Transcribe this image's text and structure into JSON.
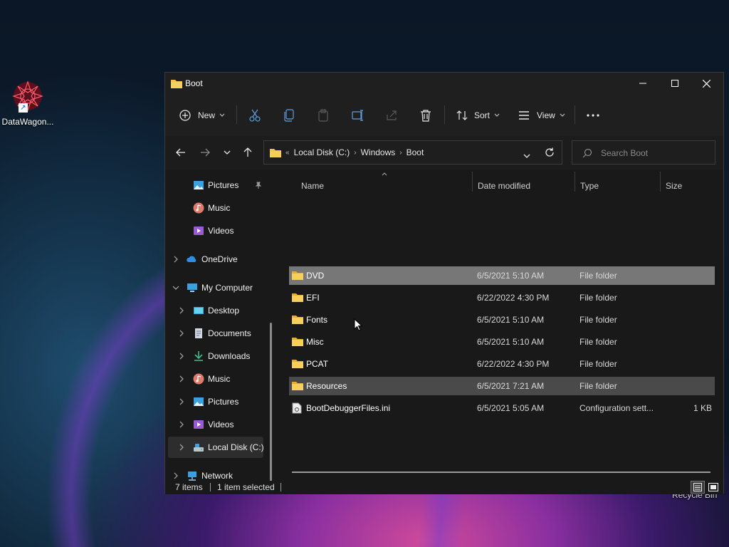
{
  "desktop": {
    "icons": [
      {
        "label": "DataWagon...",
        "icon": "datawagon-logo-icon"
      }
    ],
    "recycle_bin_label": "Recycle Bin"
  },
  "window": {
    "title": "Boot",
    "controls": [
      "minimize",
      "maximize",
      "close"
    ]
  },
  "toolbar": {
    "new_label": "New",
    "sort_label": "Sort",
    "view_label": "View",
    "icons": [
      "cut-icon",
      "copy-icon",
      "paste-icon",
      "rename-icon",
      "share-icon",
      "delete-icon",
      "more-icon"
    ]
  },
  "address": {
    "crumbs": [
      "Local Disk (C:)",
      "Windows",
      "Boot"
    ],
    "overflow": "«"
  },
  "search": {
    "placeholder": "Search Boot"
  },
  "sidebar": {
    "items": [
      {
        "label": "Pictures",
        "icon": "pictures-icon",
        "pinned": true
      },
      {
        "label": "Music",
        "icon": "music-icon"
      },
      {
        "label": "Videos",
        "icon": "videos-icon"
      },
      {
        "label": "OneDrive",
        "icon": "onedrive-icon",
        "expander": "collapsed"
      },
      {
        "label": "My Computer",
        "icon": "computer-icon",
        "expander": "expanded"
      },
      {
        "label": "Desktop",
        "icon": "desktop-icon",
        "expander": "collapsed"
      },
      {
        "label": "Documents",
        "icon": "documents-icon",
        "expander": "collapsed"
      },
      {
        "label": "Downloads",
        "icon": "downloads-icon",
        "expander": "collapsed"
      },
      {
        "label": "Music",
        "icon": "music-icon",
        "expander": "collapsed"
      },
      {
        "label": "Pictures",
        "icon": "pictures-icon",
        "expander": "collapsed"
      },
      {
        "label": "Videos",
        "icon": "videos-icon",
        "expander": "collapsed"
      },
      {
        "label": "Local Disk (C:)",
        "icon": "drive-icon",
        "expander": "collapsed",
        "selected": true
      },
      {
        "label": "Network",
        "icon": "network-icon",
        "expander": "collapsed"
      }
    ]
  },
  "columns": [
    "Name",
    "Date modified",
    "Type",
    "Size"
  ],
  "files": [
    {
      "name": "DVD",
      "date": "6/5/2021 5:10 AM",
      "type": "File folder",
      "size": "",
      "kind": "folder",
      "state": "selected"
    },
    {
      "name": "EFI",
      "date": "6/22/2022 4:30 PM",
      "type": "File folder",
      "size": "",
      "kind": "folder"
    },
    {
      "name": "Fonts",
      "date": "6/5/2021 5:10 AM",
      "type": "File folder",
      "size": "",
      "kind": "folder"
    },
    {
      "name": "Misc",
      "date": "6/5/2021 5:10 AM",
      "type": "File folder",
      "size": "",
      "kind": "folder"
    },
    {
      "name": "PCAT",
      "date": "6/22/2022 4:30 PM",
      "type": "File folder",
      "size": "",
      "kind": "folder"
    },
    {
      "name": "Resources",
      "date": "6/5/2021 7:21 AM",
      "type": "File folder",
      "size": "",
      "kind": "folder",
      "state": "hover"
    },
    {
      "name": "BootDebuggerFiles.ini",
      "date": "6/5/2021 5:05 AM",
      "type": "Configuration sett...",
      "size": "1 KB",
      "kind": "ini"
    }
  ],
  "status": {
    "item_count": "7 items",
    "selection": "1 item selected"
  },
  "colors": {
    "window_bg": "#191919",
    "selected_row": "#777777",
    "hover_row": "#4a4a4a",
    "folder": "#f2c14e"
  }
}
